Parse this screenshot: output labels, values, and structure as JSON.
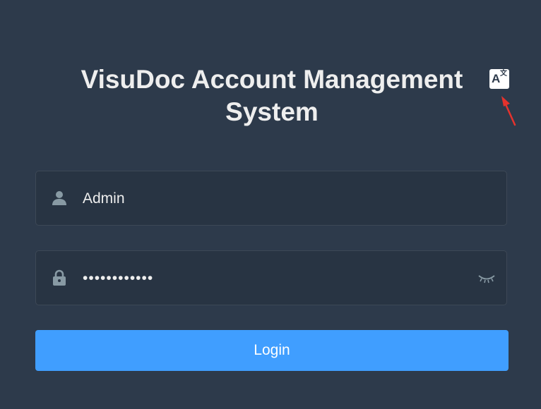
{
  "header": {
    "title": "VisuDoc Account Management System",
    "lang_icon": "translate-icon",
    "lang_glyph_latin": "A",
    "lang_glyph_cjk": "文"
  },
  "login_form": {
    "username": {
      "icon": "user-icon",
      "value": "Admin"
    },
    "password": {
      "icon": "lock-icon",
      "value": "••••••••••••",
      "toggle_icon": "eye-closed-icon"
    },
    "login_label": "Login"
  },
  "annotation": {
    "arrow_color": "#e5322d"
  },
  "colors": {
    "background": "#2d3a4b",
    "field_background": "#283443",
    "primary": "#409eff",
    "text": "#eeeeee",
    "icon": "#889aa4"
  }
}
